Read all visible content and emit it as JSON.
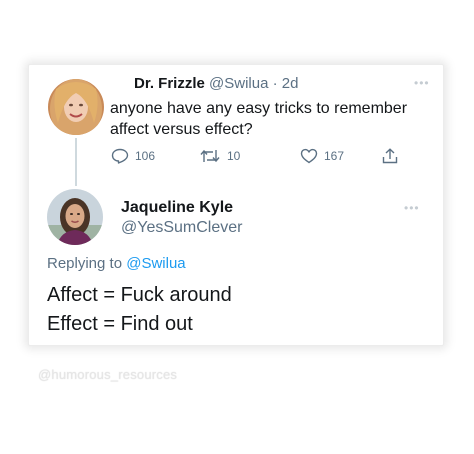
{
  "tweet": {
    "author_name": "Dr. Frizzle",
    "author_handle": "@Swilua",
    "separator": "·",
    "time": "2d",
    "text": "anyone have any easy tricks to remember affect versus effect?",
    "more_icon": "ellipsis-icon",
    "actions": {
      "reply_count": "106",
      "retweet_count": "10",
      "like_count": "167"
    }
  },
  "reply": {
    "author_name": "Jaqueline Kyle",
    "author_handle": "@YesSumClever",
    "replying_prefix": "Replying to",
    "replying_handle": "@Swilua",
    "line1": "Affect = Fuck around",
    "line2": "Effect = Find out",
    "more_icon": "ellipsis-icon"
  },
  "watermark": "@humorous_resources",
  "colors": {
    "link": "#1d9bf0",
    "secondary_text": "#5b7083",
    "thread_line": "#cfd9de"
  }
}
